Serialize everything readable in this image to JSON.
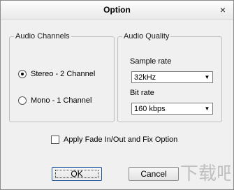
{
  "window": {
    "title": "Option",
    "close_glyph": "×"
  },
  "audio_channels": {
    "legend": "Audio Channels",
    "options": [
      {
        "label": "Stereo - 2 Channel",
        "selected": true
      },
      {
        "label": "Mono - 1 Channel",
        "selected": false
      }
    ]
  },
  "audio_quality": {
    "legend": "Audio Quality",
    "sample_rate_label": "Sample rate",
    "sample_rate_value": "32kHz",
    "bit_rate_label": "Bit rate",
    "bit_rate_value": "160 kbps"
  },
  "fade_option": {
    "label": "Apply Fade In/Out and Fix Option",
    "checked": false
  },
  "buttons": {
    "ok": "OK",
    "cancel": "Cancel"
  },
  "watermark_text": "下载吧"
}
